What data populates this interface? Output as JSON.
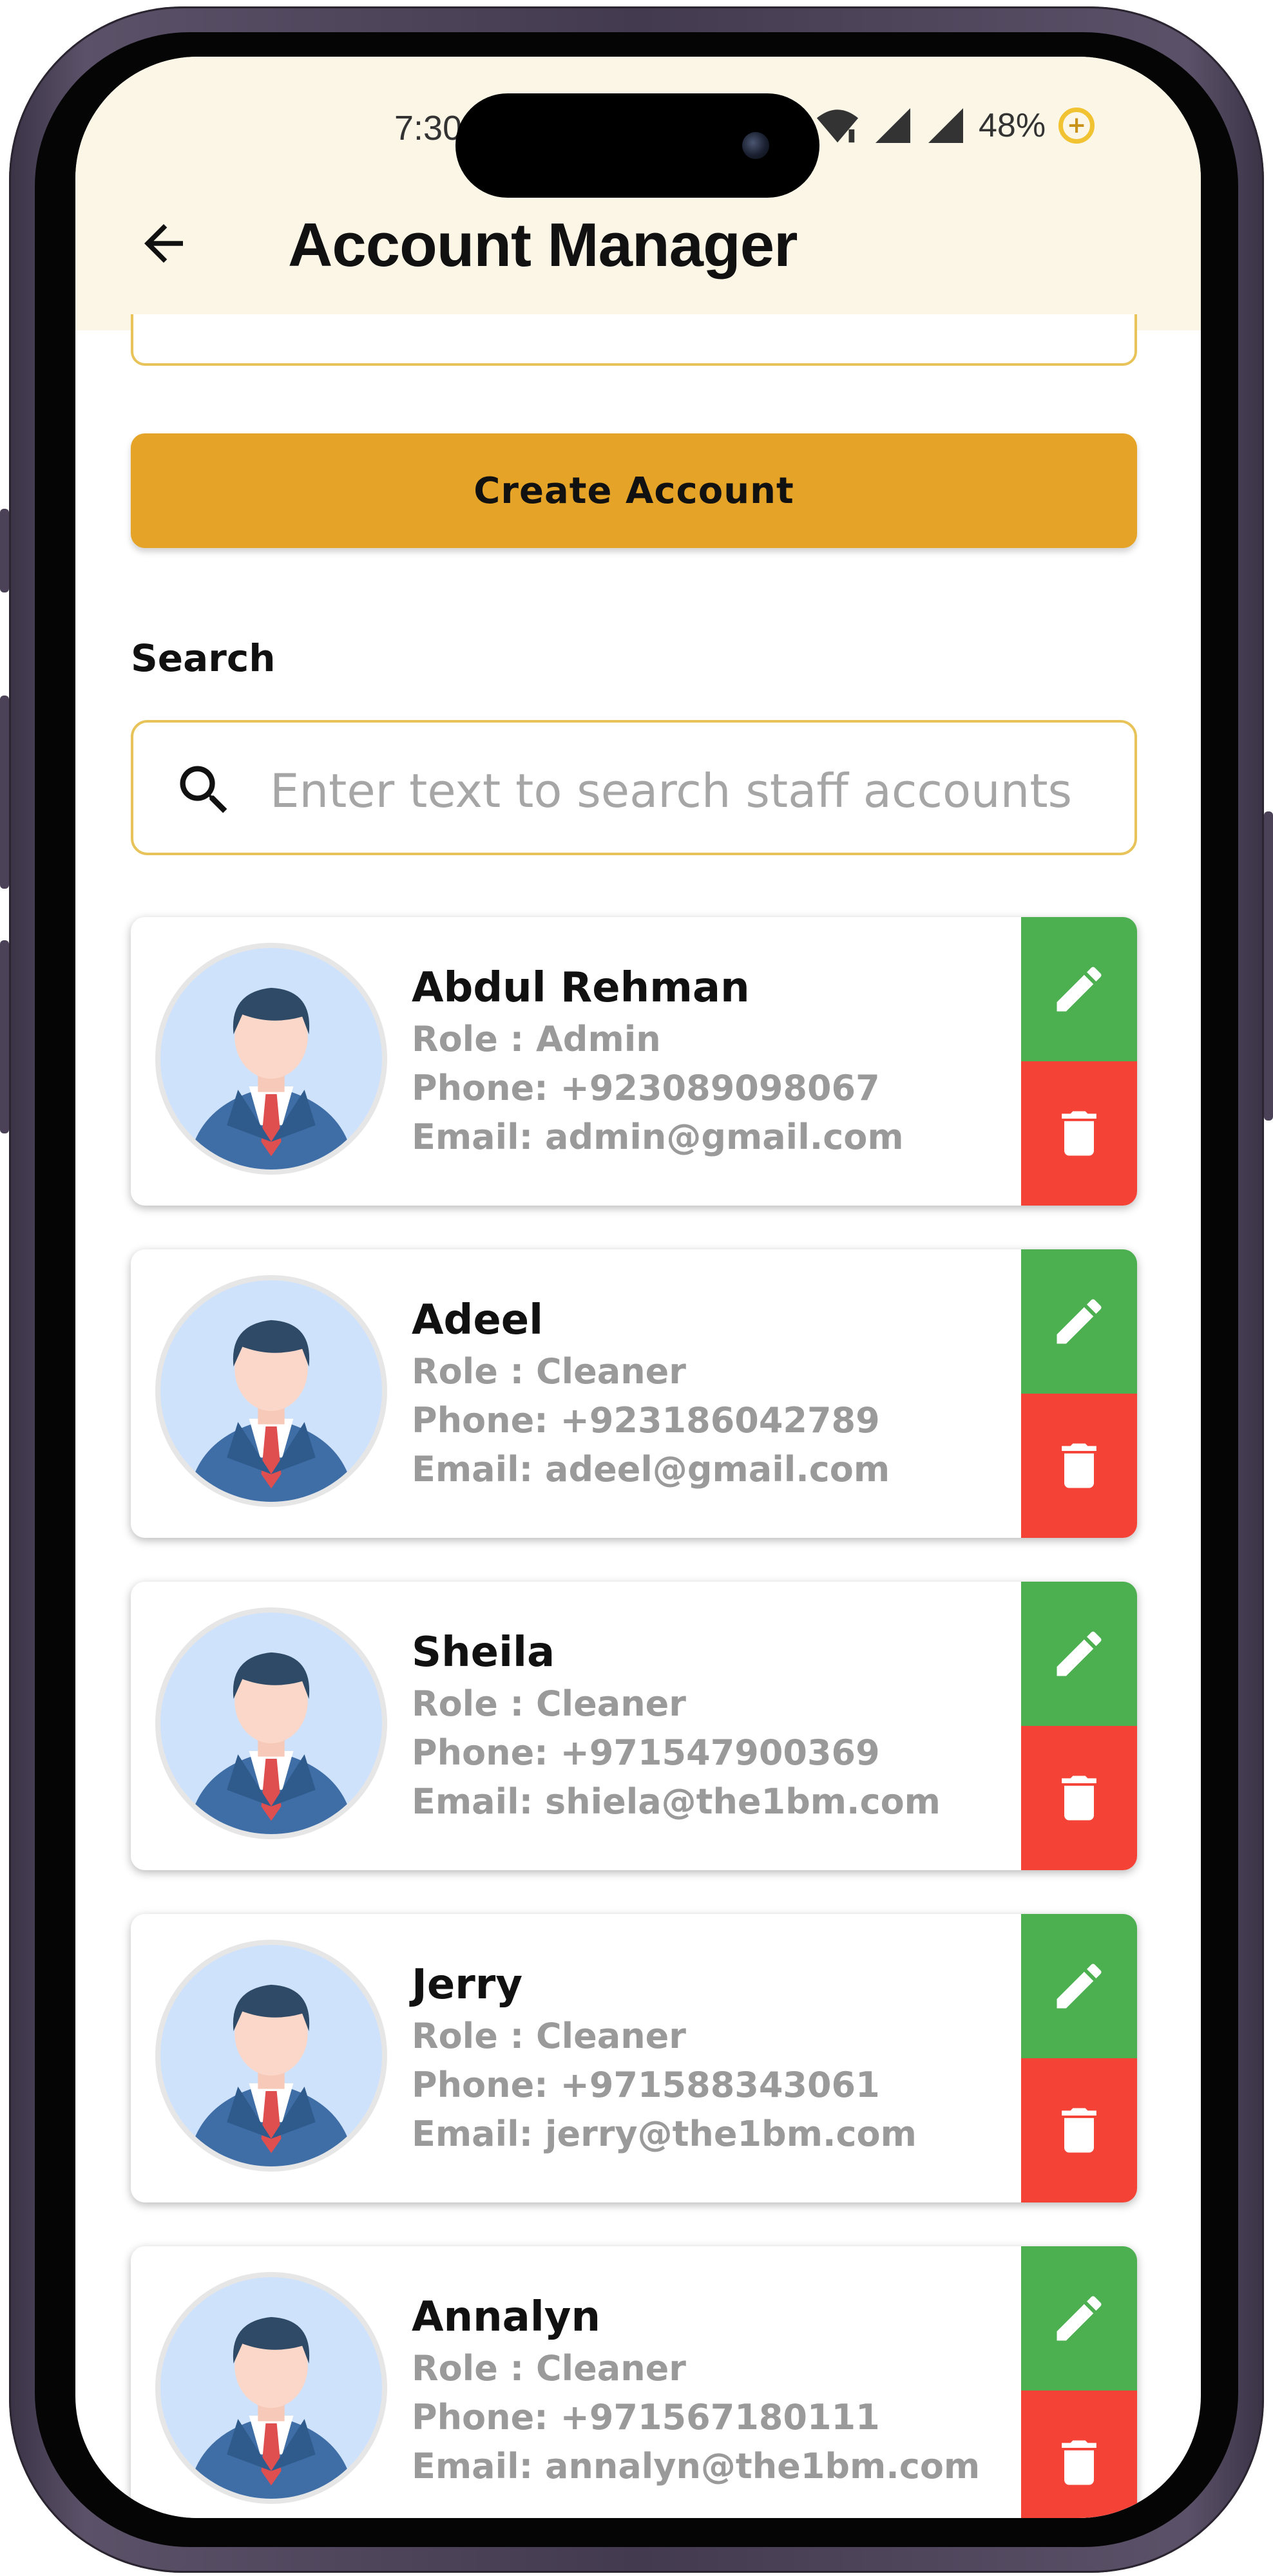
{
  "status_bar": {
    "time": "7:30",
    "battery": "48%"
  },
  "header": {
    "title": "Account Manager"
  },
  "create_button": {
    "label": "Create Account"
  },
  "search": {
    "label": "Search",
    "placeholder": "Enter text to search staff accounts",
    "value": ""
  },
  "accounts": [
    {
      "name": "Abdul Rehman",
      "role": "Role : Admin",
      "phone": "Phone: +923089098067",
      "email": "Email: admin@gmail.com"
    },
    {
      "name": "Adeel",
      "role": "Role : Cleaner",
      "phone": "Phone: +923186042789",
      "email": "Email: adeel@gmail.com"
    },
    {
      "name": "Sheila",
      "role": "Role : Cleaner",
      "phone": "Phone: +971547900369",
      "email": "Email: shiela@the1bm.com"
    },
    {
      "name": "Jerry",
      "role": "Role : Cleaner",
      "phone": "Phone: +971588343061",
      "email": "Email: jerry@the1bm.com"
    },
    {
      "name": "Annalyn",
      "role": "Role : Cleaner",
      "phone": "Phone: +971567180111",
      "email": "Email: annalyn@the1bm.com"
    }
  ],
  "icons": {
    "back": "arrow-left-icon",
    "search": "search-icon",
    "edit": "pencil-icon",
    "delete": "trash-icon"
  },
  "colors": {
    "header_bg": "#fcf6e6",
    "accent": "#e5a427",
    "edit": "#4caf50",
    "delete": "#f44336"
  }
}
